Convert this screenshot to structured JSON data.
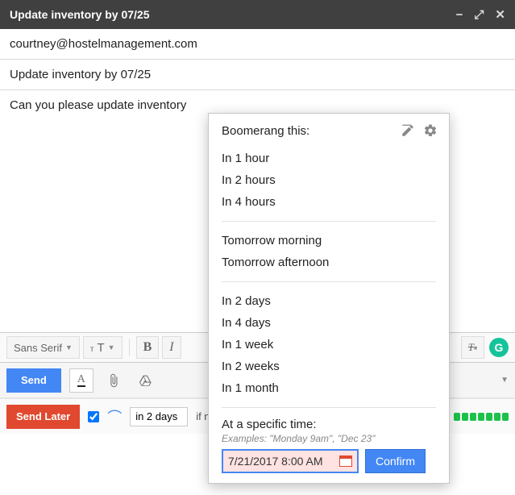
{
  "titlebar": {
    "title": "Update inventory by 07/25"
  },
  "to_field": "courtney@hostelmanagement.com",
  "subject_field": "Update inventory by 07/25",
  "body_text": "Can you please update inventory",
  "format": {
    "font_family": "Sans Serif",
    "bold": "B",
    "italic": "I"
  },
  "send_bar": {
    "send": "Send"
  },
  "boomerang_bar": {
    "send_later": "Send Later",
    "in_days_value": "in 2 days",
    "if_no_reply": "if no reply"
  },
  "popup": {
    "title": "Boomerang this:",
    "group1": [
      "In 1 hour",
      "In 2 hours",
      "In 4 hours"
    ],
    "group2": [
      "Tomorrow morning",
      "Tomorrow afternoon"
    ],
    "group3": [
      "In 2 days",
      "In 4 days",
      "In 1 week",
      "In 2 weeks",
      "In 1 month"
    ],
    "specific_label": "At a specific time:",
    "examples": "Examples: \"Monday 9am\", \"Dec 23\"",
    "time_value": "7/21/2017 8:00 AM",
    "confirm": "Confirm"
  }
}
